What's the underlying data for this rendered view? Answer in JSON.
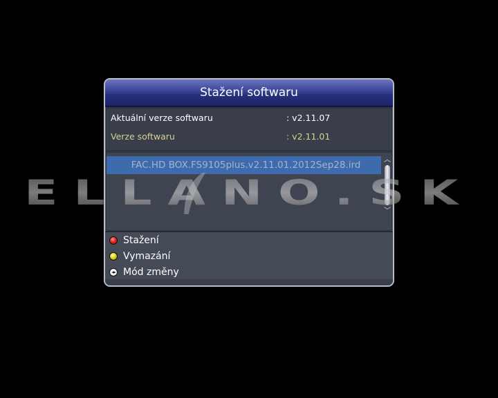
{
  "dialog": {
    "title": "Stažení softwaru",
    "current_version_label": "Aktuální verze softwaru",
    "current_version_value": ": v2.11.07",
    "file_version_label": "Verze softwaru",
    "file_version_value": ": v2.11.01",
    "files": [
      "FAC.HD BOX.FS9105plus.v2.11.01.2012Sep28.ird"
    ],
    "legend": {
      "red_label": "Stažení",
      "yellow_label": "Vymazání",
      "nav_label": "Mód změny"
    }
  },
  "watermark": {
    "text": "ELLANO.SK"
  },
  "colors": {
    "background": "#000000",
    "title_bar": "#2a3284",
    "highlight": "#3d6bae",
    "file_version_text": "#d6d28e",
    "red_button": "#e0241e",
    "yellow_button": "#e0d51e"
  },
  "icons": {
    "red_button": "red-circle-icon",
    "yellow_button": "yellow-circle-icon",
    "nav_button": "left-right-arrows-icon",
    "scroll_up": "chevron-up-icon",
    "scroll_down": "chevron-down-icon"
  }
}
